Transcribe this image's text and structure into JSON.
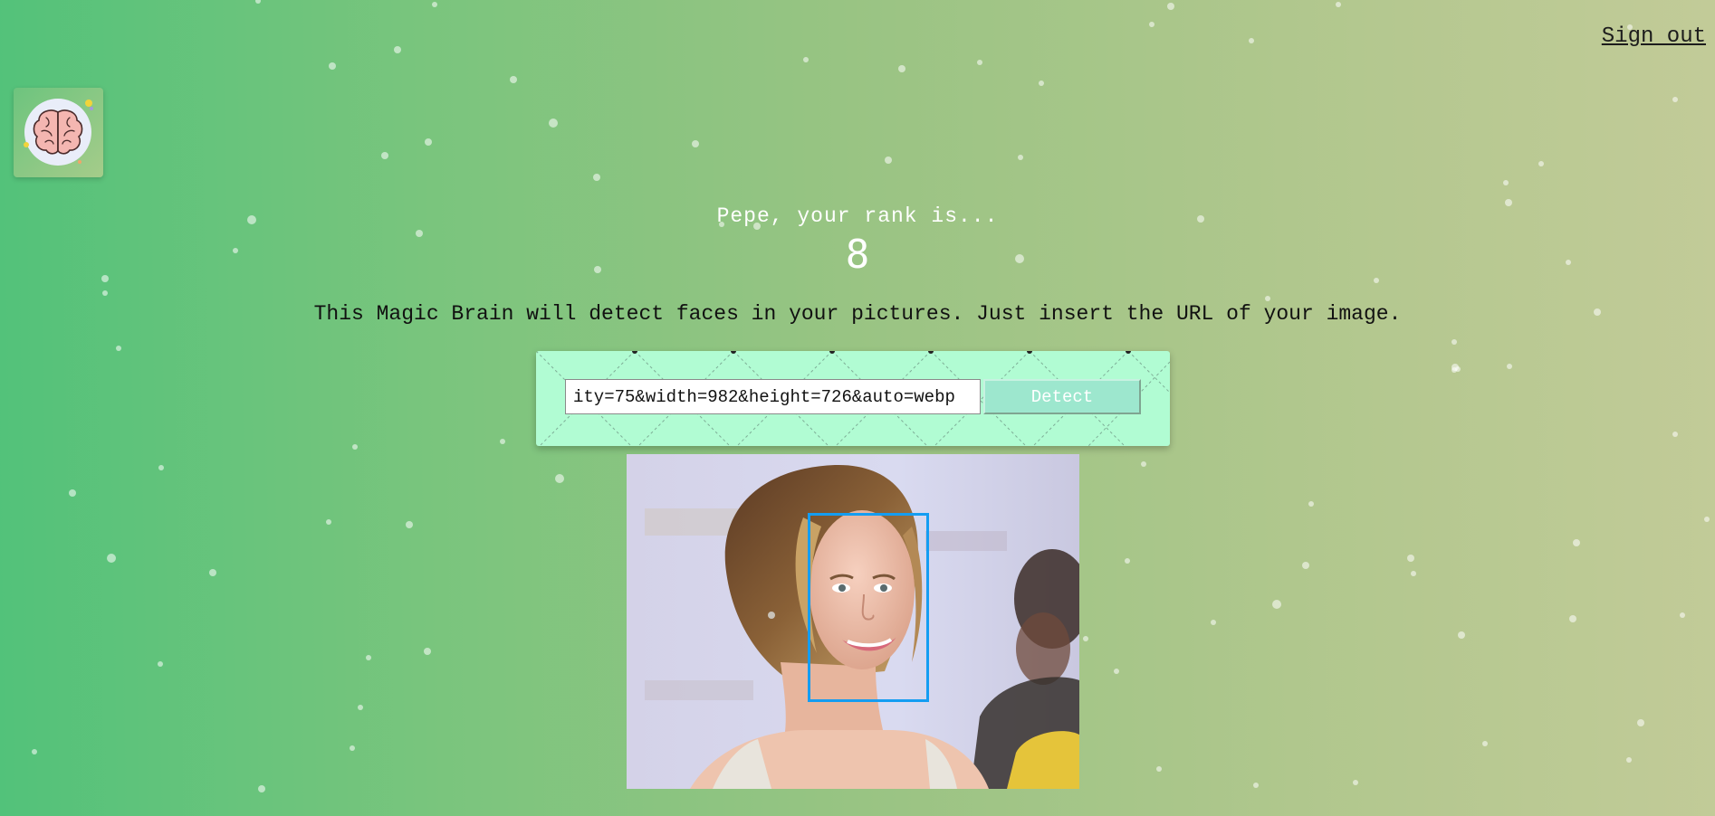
{
  "nav": {
    "signout_label": "Sign out"
  },
  "logo": {
    "icon": "brain-icon"
  },
  "rank": {
    "line": "Pepe, your rank is...",
    "value": "8"
  },
  "description": "This Magic Brain will detect faces in your pictures. Just insert the URL of your image.",
  "form": {
    "url_value": "ity=75&width=982&height=726&auto=webp",
    "detect_label": "Detect"
  },
  "result": {
    "faces_detected": 1
  },
  "colors": {
    "gradient_start": "#52c27a",
    "gradient_end": "#c2cb98",
    "panel_bg": "#b1fcd3",
    "button_bg": "#9de7ce",
    "face_box": "#149df2"
  }
}
